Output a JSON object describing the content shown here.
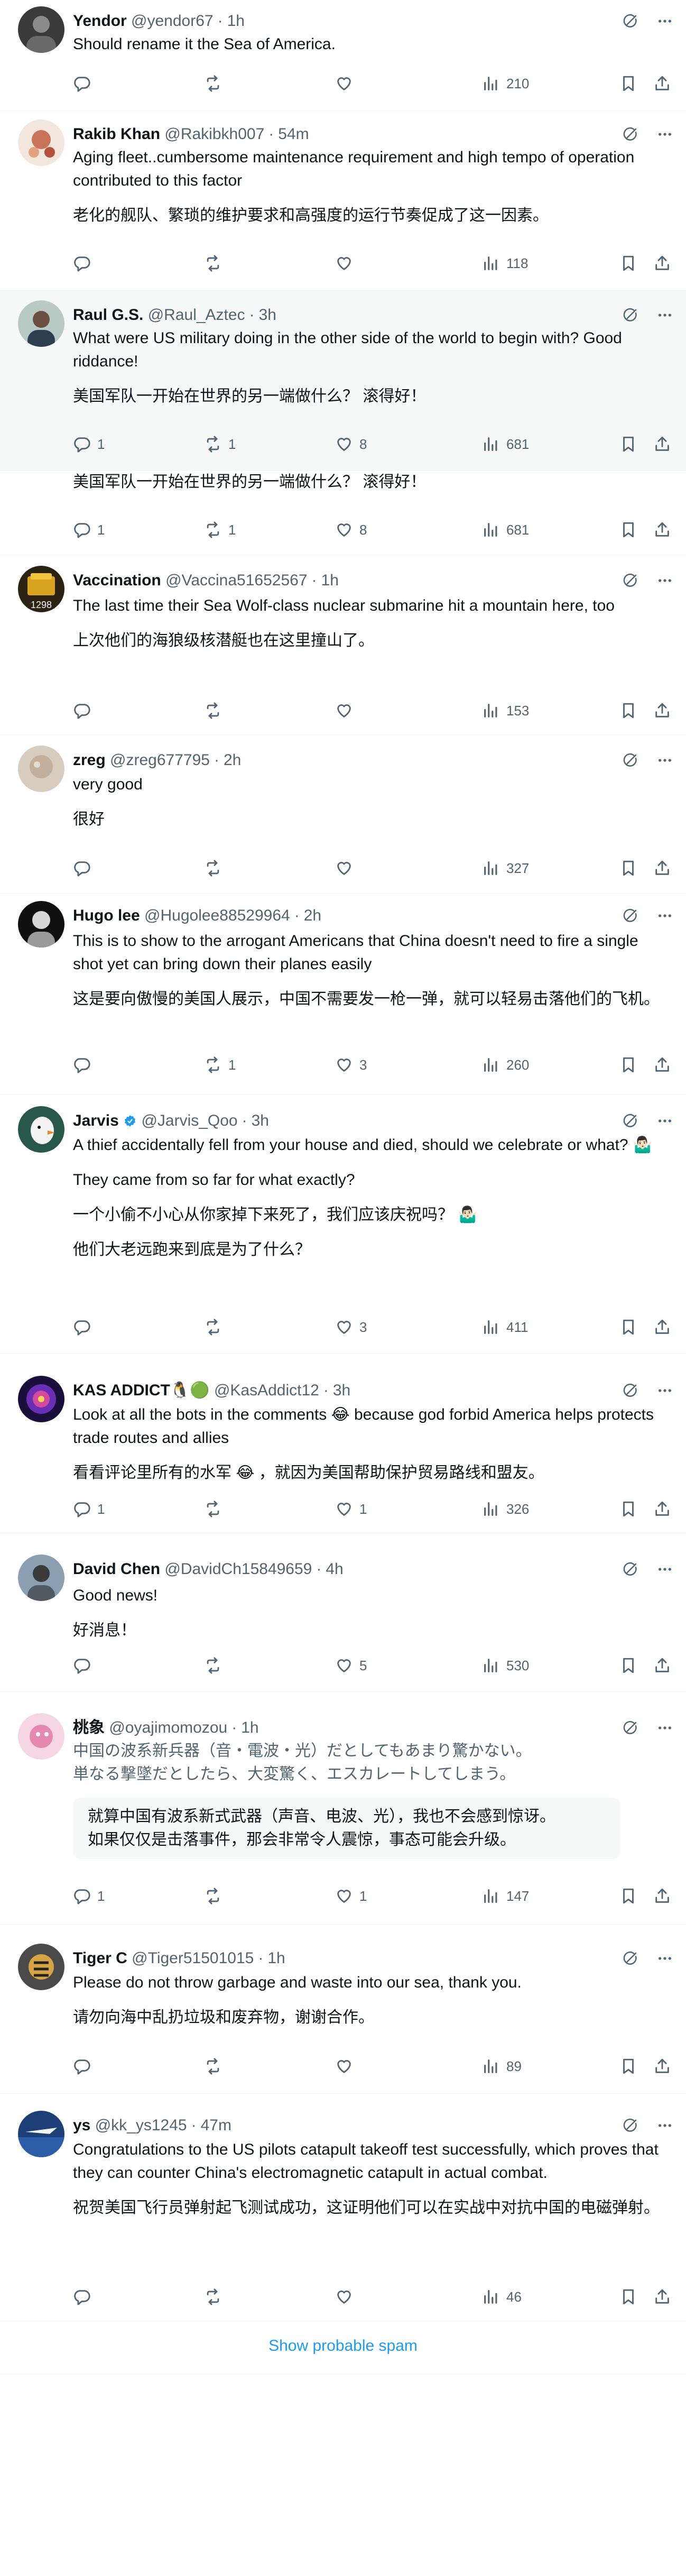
{
  "tweets": [
    {
      "name": "Yendor",
      "handle": "@yendor67",
      "sep": "·",
      "time": "1h",
      "lines": [
        "Should rename it the Sea of America."
      ],
      "replies": "",
      "retweets": "",
      "likes": "",
      "views": "210"
    },
    {
      "name": "Rakib Khan",
      "handle": "@Rakibkh007",
      "sep": "·",
      "time": "54m",
      "lines": [
        "Aging fleet..cumbersome maintenance requirement and high tempo of operation contributed to this factor",
        "",
        "老化的舰队、繁琐的维护要求和高强度的运行节奏促成了这一因素。"
      ],
      "replies": "",
      "retweets": "",
      "likes": "",
      "views": "118"
    },
    {
      "name": "Raul G.S.",
      "handle": "@Raul_Aztec",
      "sep": "·",
      "time": "3h",
      "lines": [
        "What were US military doing in the other side of the world to begin with? Good riddance!",
        "",
        "美国军队一开始在世界的另一端做什么？ 滚得好！"
      ],
      "replies": "1",
      "retweets": "1",
      "likes": "8",
      "views": "681"
    },
    {
      "name": "",
      "handle": "",
      "sep": "",
      "time": "",
      "lines": [
        "美国军队一开始在世界的另一端做什么？ 滚得好！"
      ],
      "replies": "1",
      "retweets": "1",
      "likes": "8",
      "views": "681"
    },
    {
      "name": "Vaccination",
      "handle": "@Vaccina51652567",
      "sep": "·",
      "time": "1h",
      "lines": [
        "The last time their Sea Wolf-class nuclear submarine hit a mountain here, too",
        "",
        "上次他们的海狼级核潜艇也在这里撞山了。"
      ],
      "replies": "",
      "retweets": "",
      "likes": "",
      "views": "153"
    },
    {
      "name": "zreg",
      "handle": "@zreg677795",
      "sep": "·",
      "time": "2h",
      "lines": [
        "very good",
        "",
        "很好"
      ],
      "replies": "",
      "retweets": "",
      "likes": "",
      "views": "327"
    },
    {
      "name": "Hugo lee",
      "handle": "@Hugolee88529964",
      "sep": "·",
      "time": "2h",
      "lines": [
        "This is to show to the arrogant Americans that China doesn't need to fire a single shot yet can bring down their planes easily",
        "",
        "这是要向傲慢的美国人展示，中国不需要发一枪一弹，就可以轻易击落他们的飞机。"
      ],
      "replies": "",
      "retweets": "1",
      "likes": "3",
      "views": "260"
    },
    {
      "name": "Jarvis",
      "handle": "@Jarvis_Qoo",
      "sep": "·",
      "time": "3h",
      "lines": [
        "A thief accidentally fell from your house and died, should we celebrate or what? 🤷🏻‍♂️",
        "",
        "They came from so far for what exactly?",
        "",
        "一个小偷不小心从你家掉下来死了，我们应该庆祝吗？ 🤷🏻‍♂️",
        "",
        "他们大老远跑来到底是为了什么？"
      ],
      "replies": "",
      "retweets": "",
      "likes": "3",
      "views": "411"
    },
    {
      "name": "KAS ADDICT🐧🟢",
      "handle": "@KasAddict12",
      "sep": "·",
      "time": "3h",
      "lines": [
        "Look at all the bots in the comments 😂 because god forbid America helps protects trade routes and allies",
        "",
        "看看评论里所有的水军 😂 ，就因为美国帮助保护贸易路线和盟友。"
      ],
      "replies": "1",
      "retweets": "",
      "likes": "1",
      "views": "326"
    },
    {
      "name": "David Chen",
      "handle": "@DavidCh15849659",
      "sep": "·",
      "time": "4h",
      "lines": [
        "Good news!",
        "",
        "好消息！"
      ],
      "replies": "",
      "retweets": "",
      "likes": "5",
      "views": "530"
    },
    {
      "name": "桃象",
      "handle": "@oyajimomozou",
      "sep": "·",
      "time": "1h",
      "lines": [
        "中国の波系新兵器（音・電波・光）だとしてもあまり驚かない。",
        "単なる撃墜だとしたら、大変驚く、エスカレートしてしまう。"
      ],
      "quote": [
        "就算中国有波系新式武器（声音、电波、光），我也不会感到惊讶。",
        "如果仅仅是击落事件，那会非常令人震惊，事态可能会升级。"
      ],
      "replies": "1",
      "retweets": "",
      "likes": "1",
      "views": "147"
    },
    {
      "name": "Tiger C",
      "handle": "@Tiger51501015",
      "sep": "·",
      "time": "1h",
      "lines": [
        "Please do not throw garbage and waste into our sea, thank you.",
        "",
        "请勿向海中乱扔垃圾和废弃物，谢谢合作。"
      ],
      "replies": "",
      "retweets": "",
      "likes": "",
      "views": "89"
    },
    {
      "name": "ys",
      "handle": "@kk_ys1245",
      "sep": "·",
      "time": "47m",
      "lines": [
        "Congratulations to the US pilots  catapult takeoff test successfully, which proves that they can counter China's electromagnetic catapult in actual combat.",
        "",
        "祝贺美国飞行员弹射起飞测试成功，这证明他们可以在实战中对抗中国的电磁弹射。"
      ],
      "replies": "",
      "retweets": "",
      "likes": "",
      "views": "46"
    }
  ],
  "show_spam": "Show probable spam",
  "avatar_badge": "1298",
  "colors": {
    "text": "#0f1419",
    "muted": "#536471",
    "link": "#1d9bf0",
    "border": "#eff3f4",
    "highlight": "#f7f9f9",
    "verified": "#1d9bf0",
    "green": "#00ba7c"
  },
  "icons": [
    "grok-icon",
    "more-icon",
    "reply-icon",
    "retweet-icon",
    "like-icon",
    "views-icon",
    "bookmark-icon",
    "share-icon",
    "verified-badge-icon"
  ]
}
